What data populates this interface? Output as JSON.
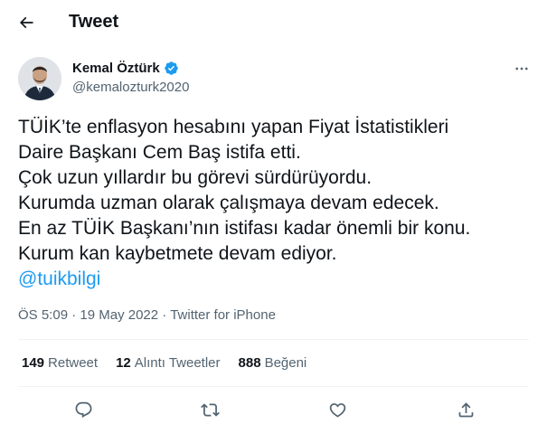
{
  "header": {
    "title": "Tweet"
  },
  "author": {
    "name": "Kemal Öztürk",
    "handle": "@kemalozturk2020",
    "verified": true
  },
  "tweet": {
    "lines": [
      "TÜİK’te enflasyon hesabını yapan Fiyat İstatistikleri",
      "Daire Başkanı Cem Baş istifa etti.",
      "Çok uzun yıllardır bu görevi sürdürüyordu.",
      "Kurumda uzman olarak çalışmaya devam edecek.",
      "En az TÜİK Başkanı’nın istifası kadar önemli bir konu.",
      "Kurum kan kaybetmete devam ediyor."
    ],
    "mention": "@tuikbilgi"
  },
  "meta": {
    "time": "ÖS 5:09",
    "separator": "·",
    "date": "19 May 2022",
    "source": "Twitter for iPhone"
  },
  "stats": {
    "retweets": {
      "count": "149",
      "label": "Retweet"
    },
    "quotes": {
      "count": "12",
      "label": "Alıntı Tweetler"
    },
    "likes": {
      "count": "888",
      "label": "Beğeni"
    }
  },
  "icons": {
    "back": "arrow-left-icon",
    "more": "more-horizontal-icon",
    "reply": "reply-icon",
    "retweet": "retweet-icon",
    "like": "heart-icon",
    "share": "share-icon",
    "verified": "verified-badge-icon"
  },
  "colors": {
    "accent": "#1d9bf0",
    "text": "#0f1419",
    "secondary": "#536471",
    "divider": "#eff3f4"
  }
}
